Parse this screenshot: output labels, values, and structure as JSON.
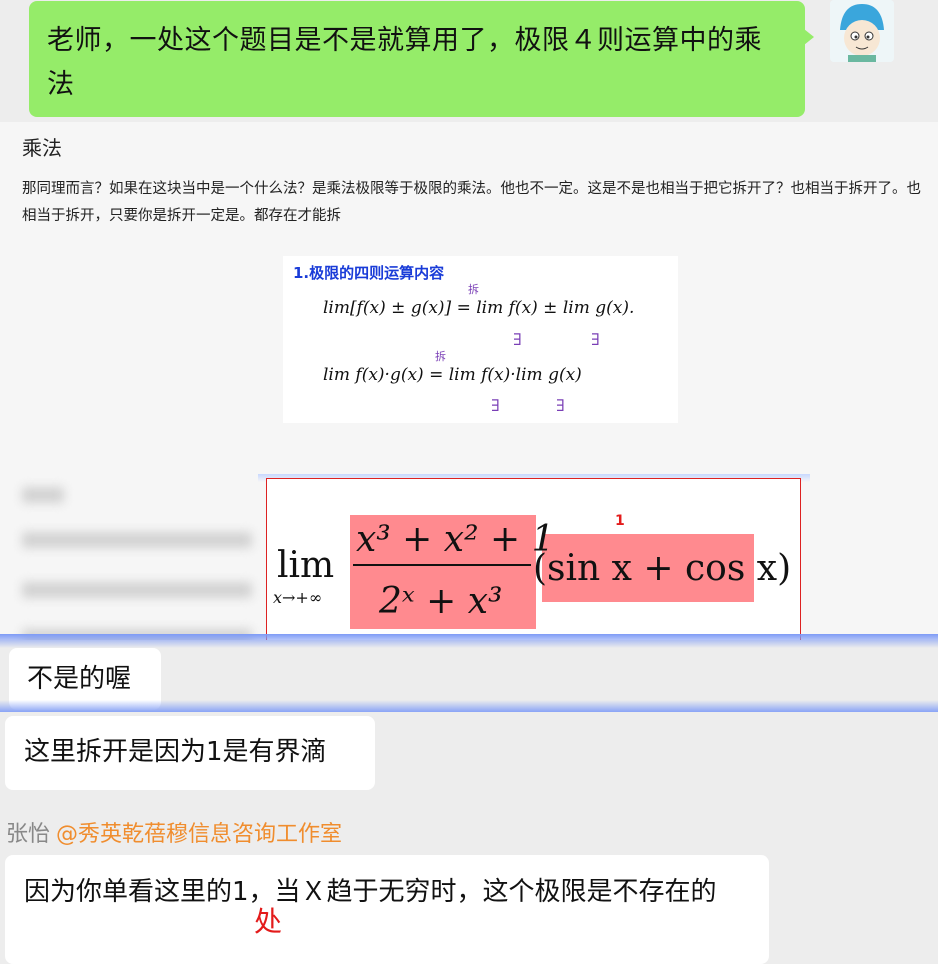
{
  "self_message": {
    "text": "老师，一处这个题目是不是就算用了，极限４则运算中的乘法"
  },
  "document": {
    "title": "乘法",
    "paragraph": "那同理而言？如果在这块当中是一个什么法？是乘法极限等于极限的乘法。他也不一定。这是不是也相当于把它拆开了？也相当于拆开了。也相当于拆开，只要你是拆开一定是。都存在才能拆",
    "formula_image": {
      "heading": "1.极限的四则运算内容",
      "line1": "lim[f(x) ± g(x)] = lim f(x) ± lim g(x).",
      "line2": "lim f(x)·g(x) = lim f(x)·lim g(x)",
      "annotation_split": "拆",
      "annotation_exists": "∃"
    },
    "expression": {
      "lim": "lim",
      "lim_sub": "x→+∞",
      "numerator": "x³ + x² + 1",
      "denominator": "2ˣ + x³",
      "factor": "(sin x + cos x) =",
      "marker": "1"
    }
  },
  "replies": [
    {
      "text": "不是的喔"
    },
    {
      "text": "这里拆开是因为1是有界滴"
    }
  ],
  "sender": {
    "name": "张怡",
    "mention": "@秀英乾蓓穆信息咨询工作室"
  },
  "last_message": {
    "text": "因为你单看这里的1，当Ｘ趋于无穷时，这个极限是不存在的"
  },
  "overlay_char": "处",
  "colors": {
    "self_bubble": "#95ec69",
    "highlight": "#ff8a8f",
    "mention": "#f08d2e",
    "accent_red": "#e31b1b"
  }
}
